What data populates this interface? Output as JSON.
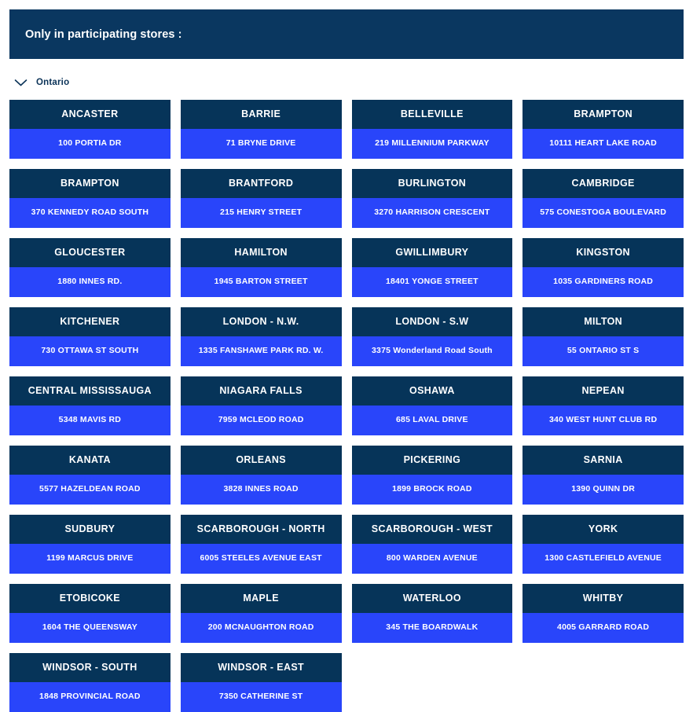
{
  "banner": {
    "title": "Only in participating stores :",
    "background_color": "#0a3760",
    "text_color": "#ffffff"
  },
  "province": {
    "label": "Ontario",
    "chevron_icon": "chevron-down-icon",
    "expanded": true
  },
  "colors": {
    "card_header": "#063459",
    "card_body": "#2945fa",
    "banner": "#0a3760",
    "page_background": "#ffffff",
    "label_text": "#0b3358"
  },
  "stores": [
    {
      "city": "ANCASTER",
      "address": "100 PORTIA DR"
    },
    {
      "city": "BARRIE",
      "address": "71 BRYNE DRIVE"
    },
    {
      "city": "BELLEVILLE",
      "address": "219 MILLENNIUM PARKWAY"
    },
    {
      "city": "BRAMPTON",
      "address": "10111 HEART LAKE ROAD"
    },
    {
      "city": "BRAMPTON",
      "address": "370 KENNEDY ROAD SOUTH"
    },
    {
      "city": "BRANTFORD",
      "address": "215 HENRY STREET"
    },
    {
      "city": "BURLINGTON",
      "address": "3270 HARRISON CRESCENT"
    },
    {
      "city": "CAMBRIDGE",
      "address": "575 CONESTOGA BOULEVARD"
    },
    {
      "city": "GLOUCESTER",
      "address": "1880 INNES RD."
    },
    {
      "city": "HAMILTON",
      "address": "1945 BARTON STREET"
    },
    {
      "city": "GWILLIMBURY",
      "address": "18401 YONGE STREET"
    },
    {
      "city": "KINGSTON",
      "address": "1035 GARDINERS ROAD"
    },
    {
      "city": "KITCHENER",
      "address": "730 OTTAWA ST SOUTH"
    },
    {
      "city": "LONDON - N.W.",
      "address": "1335 FANSHAWE PARK RD. W."
    },
    {
      "city": "LONDON - S.W",
      "address": "3375 Wonderland Road South"
    },
    {
      "city": "MILTON",
      "address": "55 ONTARIO ST S"
    },
    {
      "city": "CENTRAL MISSISSAUGA",
      "address": "5348 MAVIS RD"
    },
    {
      "city": "NIAGARA FALLS",
      "address": "7959 MCLEOD ROAD"
    },
    {
      "city": "OSHAWA",
      "address": "685 LAVAL DRIVE"
    },
    {
      "city": "NEPEAN",
      "address": "340 WEST HUNT CLUB RD"
    },
    {
      "city": "KANATA",
      "address": "5577 HAZELDEAN ROAD"
    },
    {
      "city": "ORLEANS",
      "address": "3828 INNES ROAD"
    },
    {
      "city": "PICKERING",
      "address": "1899 BROCK ROAD"
    },
    {
      "city": "SARNIA",
      "address": "1390 QUINN DR"
    },
    {
      "city": "SUDBURY",
      "address": "1199 MARCUS DRIVE"
    },
    {
      "city": "SCARBOROUGH - NORTH",
      "address": "6005 STEELES AVENUE EAST"
    },
    {
      "city": "SCARBOROUGH - WEST",
      "address": "800 WARDEN AVENUE"
    },
    {
      "city": "YORK",
      "address": "1300 CASTLEFIELD AVENUE"
    },
    {
      "city": "ETOBICOKE",
      "address": "1604 THE QUEENSWAY"
    },
    {
      "city": "MAPLE",
      "address": "200 MCNAUGHTON ROAD"
    },
    {
      "city": "WATERLOO",
      "address": "345 THE BOARDWALK"
    },
    {
      "city": "WHITBY",
      "address": "4005 GARRARD ROAD"
    },
    {
      "city": "WINDSOR - SOUTH",
      "address": "1848 PROVINCIAL ROAD"
    },
    {
      "city": "WINDSOR - EAST",
      "address": "7350 CATHERINE ST"
    }
  ]
}
